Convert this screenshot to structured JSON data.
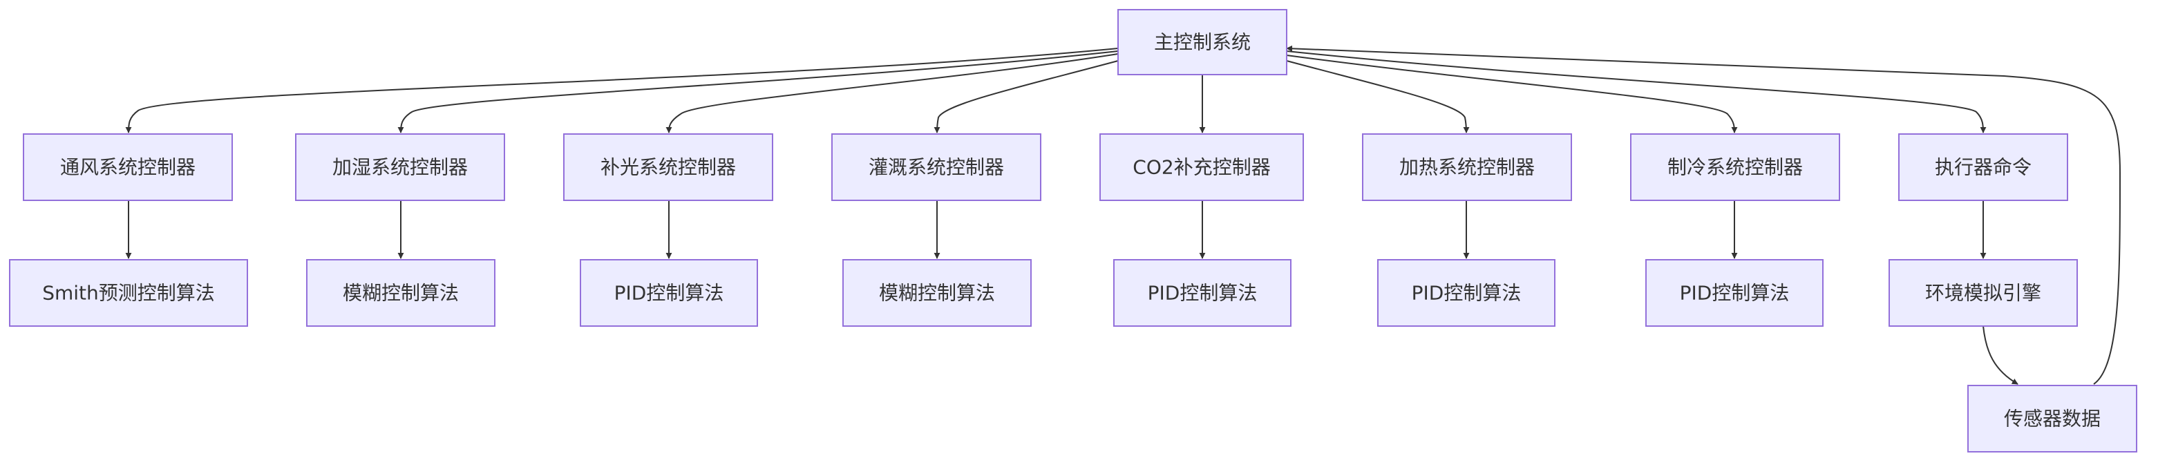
{
  "diagram": {
    "type": "flowchart",
    "colors": {
      "node_fill": "#ECECFF",
      "node_border": "#9370DB",
      "edge": "#333333",
      "text": "#333333"
    },
    "nodes": {
      "main": "主控制系统",
      "ventilation_ctrl": "通风系统控制器",
      "humidify_ctrl": "加湿系统控制器",
      "light_ctrl": "补光系统控制器",
      "irrigation_ctrl": "灌溉系统控制器",
      "co2_ctrl": "CO2补充控制器",
      "heating_ctrl": "加热系统控制器",
      "cooling_ctrl": "制冷系统控制器",
      "exec_cmd": "执行器命令",
      "smith_algo": "Smith预测控制算法",
      "fuzzy_algo_1": "模糊控制算法",
      "pid_algo_1": "PID控制算法",
      "fuzzy_algo_2": "模糊控制算法",
      "pid_algo_2": "PID控制算法",
      "pid_algo_3": "PID控制算法",
      "pid_algo_4": "PID控制算法",
      "env_sim": "环境模拟引擎",
      "sensor_data": "传感器数据"
    },
    "edges": [
      [
        "main",
        "ventilation_ctrl"
      ],
      [
        "main",
        "humidify_ctrl"
      ],
      [
        "main",
        "light_ctrl"
      ],
      [
        "main",
        "irrigation_ctrl"
      ],
      [
        "main",
        "co2_ctrl"
      ],
      [
        "main",
        "heating_ctrl"
      ],
      [
        "main",
        "cooling_ctrl"
      ],
      [
        "main",
        "exec_cmd"
      ],
      [
        "ventilation_ctrl",
        "smith_algo"
      ],
      [
        "humidify_ctrl",
        "fuzzy_algo_1"
      ],
      [
        "light_ctrl",
        "pid_algo_1"
      ],
      [
        "irrigation_ctrl",
        "fuzzy_algo_2"
      ],
      [
        "co2_ctrl",
        "pid_algo_2"
      ],
      [
        "heating_ctrl",
        "pid_algo_3"
      ],
      [
        "cooling_ctrl",
        "pid_algo_4"
      ],
      [
        "exec_cmd",
        "env_sim"
      ],
      [
        "env_sim",
        "sensor_data"
      ],
      [
        "sensor_data",
        "main"
      ]
    ]
  }
}
